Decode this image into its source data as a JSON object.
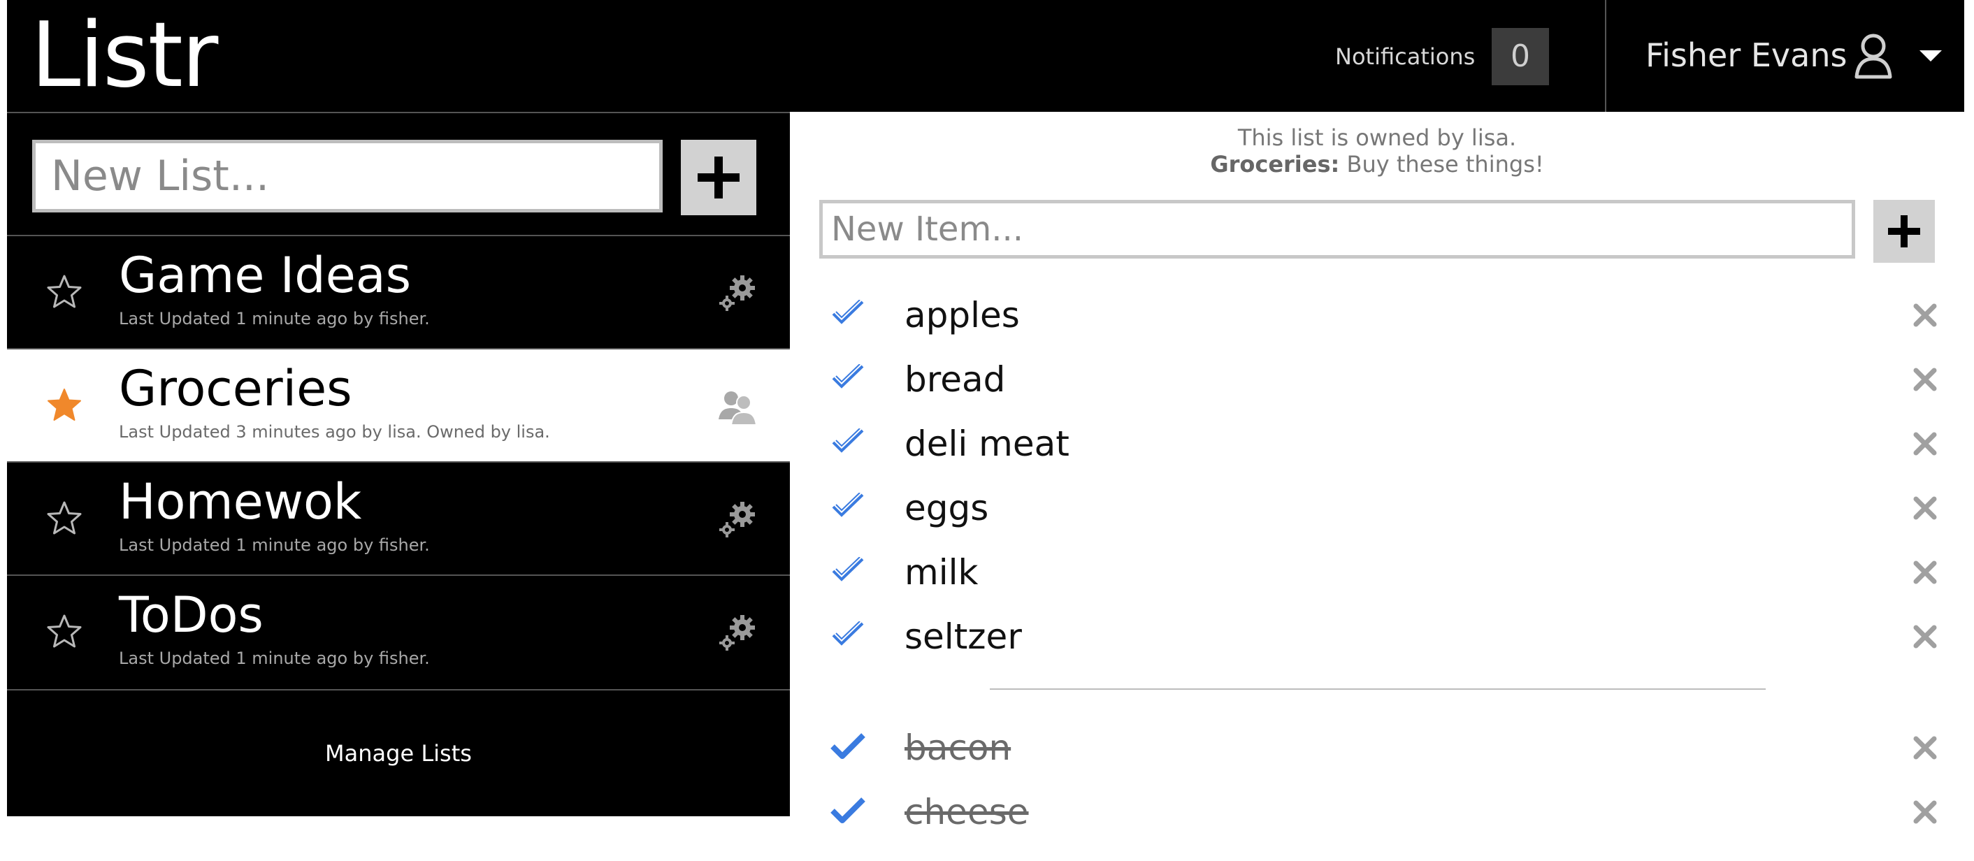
{
  "header": {
    "logo": "Listr",
    "notifications_label": "Notifications",
    "notifications_count": "0",
    "user_name": "Fisher Evans"
  },
  "sidebar": {
    "new_list_placeholder": "New List...",
    "lists": [
      {
        "title": "Game Ideas",
        "meta": "Last Updated 1 minute ago by fisher.",
        "starred": false,
        "action_icon": "gear-icon",
        "selected": false
      },
      {
        "title": "Groceries",
        "meta": "Last Updated 3 minutes ago by lisa. Owned by lisa.",
        "starred": true,
        "action_icon": "shared-users-icon",
        "selected": true
      },
      {
        "title": "Homewok",
        "meta": "Last Updated 1 minute ago by fisher.",
        "starred": false,
        "action_icon": "gear-icon",
        "selected": false
      },
      {
        "title": "ToDos",
        "meta": "Last Updated 1 minute ago by fisher.",
        "starred": false,
        "action_icon": "gear-icon",
        "selected": false
      }
    ],
    "manage_lists_label": "Manage Lists"
  },
  "main": {
    "owner_text": "This list is owned by lisa.",
    "list_name": "Groceries:",
    "list_description": "Buy these things!",
    "new_item_placeholder": "New Item...",
    "open_items": [
      "apples",
      "bread",
      "deli meat",
      "eggs",
      "milk",
      "seltzer"
    ],
    "completed_items": [
      "bacon",
      "cheese"
    ]
  },
  "colors": {
    "accent_star": "#f0882b",
    "check_blue": "#3a7be0",
    "header_bg": "#000000",
    "delete_gray": "#a0a0a0"
  }
}
